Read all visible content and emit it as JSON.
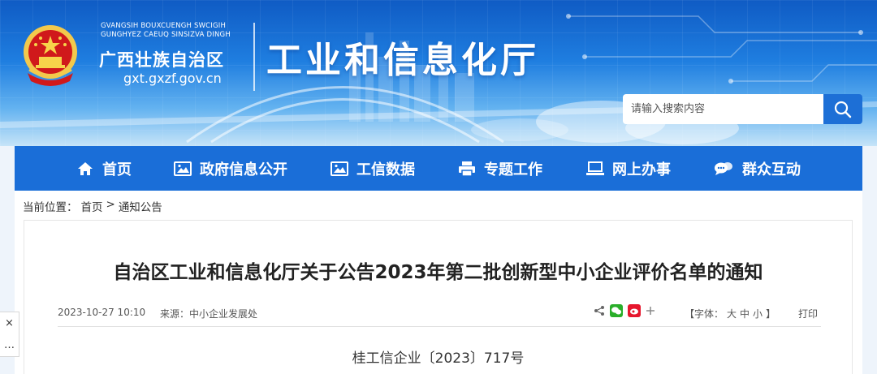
{
  "header": {
    "pinyin_line1": "GVANGSIH BOUXCUENGH SWCIGIH",
    "pinyin_line2": "GUNGHYEZ CAEUQ SINSIZVA DINGH",
    "region_name": "广西壮族自治区",
    "domain": "gxt.gxzf.gov.cn",
    "dept_title": "工业和信息化厅",
    "emblem_icon": "national-emblem-icon"
  },
  "search": {
    "placeholder": "请输入搜索内容",
    "button_icon": "search-icon"
  },
  "nav": {
    "items": [
      {
        "label": "首页",
        "icon": "home-icon"
      },
      {
        "label": "政府信息公开",
        "icon": "image-icon"
      },
      {
        "label": "工信数据",
        "icon": "image-icon"
      },
      {
        "label": "专题工作",
        "icon": "printer-icon"
      },
      {
        "label": "网上办事",
        "icon": "laptop-icon"
      },
      {
        "label": "群众互动",
        "icon": "chat-icon"
      }
    ]
  },
  "breadcrumb": {
    "prefix": "当前位置：",
    "items": [
      "首页",
      "通知公告"
    ],
    "separator": ">"
  },
  "article": {
    "title": "自治区工业和信息化厅关于公告2023年第二批创新型中小企业评价名单的通知",
    "date": "2023-10-27 10:10",
    "source": "来源：中小企业发展处",
    "font_size_prefix": "【字体：",
    "font_sizes": [
      "大",
      "中",
      "小"
    ],
    "font_size_suffix": "】",
    "print_label": "打印",
    "doc_number": "桂工信企业〔2023〕717号"
  },
  "side_float": {
    "close_label": "×",
    "more_label": "…"
  },
  "colors": {
    "nav_bg": "#1a6ed8",
    "banner_top": "#0f5bc4",
    "page_bg": "#eef4fb"
  }
}
